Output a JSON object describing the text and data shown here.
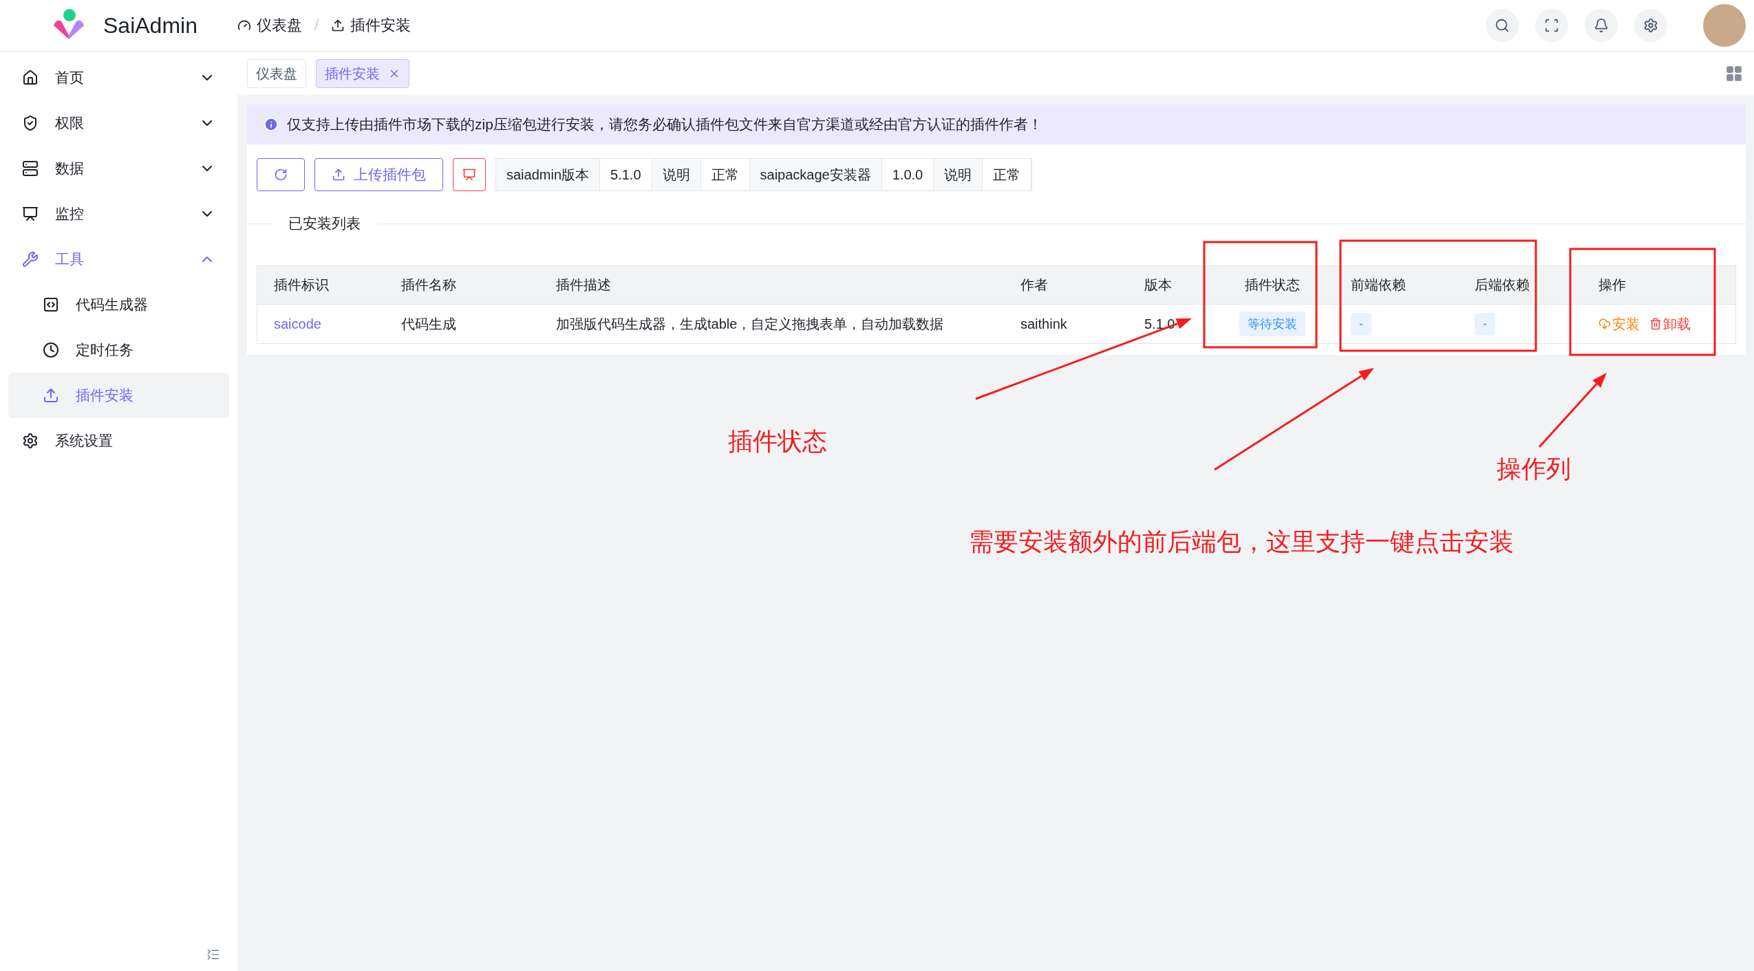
{
  "header": {
    "app_name": "SaiAdmin",
    "breadcrumb": [
      {
        "label": "仪表盘"
      },
      {
        "label": "插件安装"
      }
    ],
    "breadcrumb_separator": "/"
  },
  "sidebar": {
    "items": [
      {
        "label": "首页",
        "expanded": false,
        "selected": false
      },
      {
        "label": "权限",
        "expanded": false,
        "selected": false
      },
      {
        "label": "数据",
        "expanded": false,
        "selected": false
      },
      {
        "label": "监控",
        "expanded": false,
        "selected": false
      },
      {
        "label": "工具",
        "expanded": true,
        "selected": true,
        "children": [
          {
            "label": "代码生成器",
            "selected": false
          },
          {
            "label": "定时任务",
            "selected": false
          },
          {
            "label": "插件安装",
            "selected": true
          }
        ]
      },
      {
        "label": "系统设置",
        "selected": false
      }
    ]
  },
  "tabs": [
    {
      "label": "仪表盘",
      "selected": false,
      "closable": false
    },
    {
      "label": "插件安装",
      "selected": true,
      "closable": true
    }
  ],
  "alert": "仅支持上传由插件市场下载的zip压缩包进行安装，请您务必确认插件包文件来自官方渠道或经由官方认证的插件作者！",
  "toolbar": {
    "upload_button": "上传插件包",
    "versions": [
      {
        "label": "saiadmin版本",
        "value": "5.1.0",
        "link": "说明",
        "status": "正常"
      },
      {
        "label": "saipackage安装器",
        "value": "1.0.0",
        "link": "说明",
        "status": "正常"
      }
    ]
  },
  "section_title": "已安装列表",
  "table": {
    "columns": [
      "插件标识",
      "插件名称",
      "插件描述",
      "作者",
      "版本",
      "插件状态",
      "前端依赖",
      "后端依赖",
      "操作"
    ],
    "rows": [
      {
        "key": "saicode",
        "name": "代码生成",
        "description": "加强版代码生成器，生成table，自定义拖拽表单，自动加载数据",
        "author": "saithink",
        "version": "5.1.0",
        "status": "等待安装",
        "frontend": "-",
        "backend": "-",
        "actions": [
          {
            "label": "安装",
            "kind": "install"
          },
          {
            "label": "卸载",
            "kind": "uninstall"
          }
        ]
      }
    ]
  },
  "annotations": [
    {
      "text": "插件状态",
      "kind": "status"
    },
    {
      "text": "需要安装额外的前后端包，这里支持一键点击安装",
      "kind": "deps"
    },
    {
      "text": "操作列",
      "kind": "actions"
    }
  ]
}
